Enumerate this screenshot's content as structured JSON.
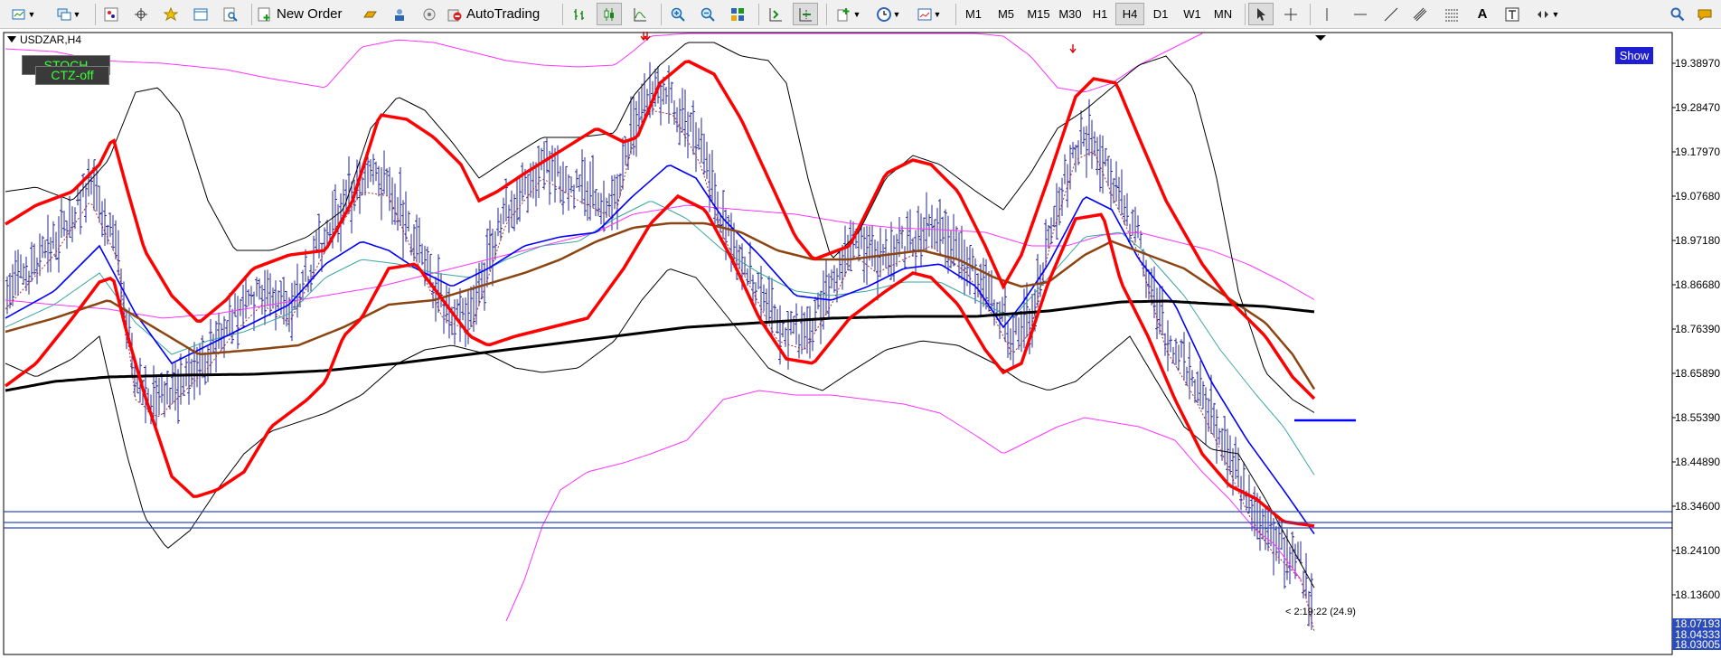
{
  "toolbar": {
    "new_order_label": "New Order",
    "autotrading_label": "AutoTrading",
    "active_timeframe": "H4",
    "timeframes": [
      "M1",
      "M5",
      "M15",
      "M30",
      "H1",
      "H4",
      "D1",
      "W1",
      "MN"
    ]
  },
  "chart": {
    "symbol_label": "USDZAR,H4",
    "stoch_button": "STOCH",
    "ctz_button": "CTZ-off",
    "show_button": "Show",
    "countdown_label": "< 2:19:22 (24.9)",
    "price_scale": [
      "19.38970",
      "19.28470",
      "19.17970",
      "19.07680",
      "18.97180",
      "18.86680",
      "18.76390",
      "18.65890",
      "18.55390",
      "18.44890",
      "18.34600",
      "18.24100",
      "18.13600"
    ],
    "price_tags": [
      "18.07193",
      "18.04333",
      "18.03005"
    ]
  },
  "colors": {
    "bid_tag": "#2c4cb8",
    "ma_red": "#ff0000",
    "ma_blue": "#0000ff",
    "ma_brown": "#8b4513",
    "ma_black": "#000000",
    "envelope_magenta": "#ff33ff",
    "bars": "#23239a",
    "stoch_text": "#3cff3c",
    "show_bg": "#1f1fd1"
  }
}
